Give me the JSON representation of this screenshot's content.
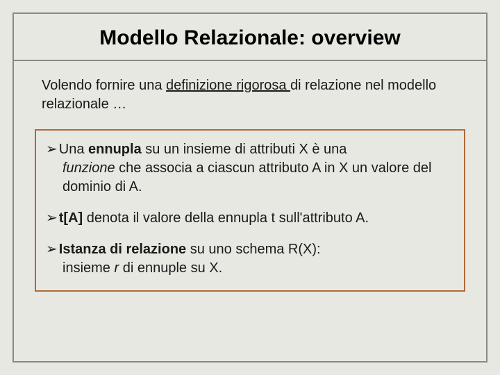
{
  "title": "Modello Relazionale: overview",
  "intro": {
    "before": "Volendo fornire una ",
    "underlined": "definizione rigorosa ",
    "after": "di relazione nel modello relazionale …"
  },
  "bullets": {
    "arrow": "➢",
    "item1": {
      "a": "Una ",
      "b": "ennupla",
      "c": " su un insieme di attributi  X  è una ",
      "d": "funzione",
      "e": " che associa a ciascun attributo  A in X un valore del dominio di A."
    },
    "item2": {
      "a": "t[A]",
      "b": " denota il valore della ennupla t sull'attributo A."
    },
    "item3": {
      "a": "Istanza di relazione",
      "b": " su uno schema  R(X): insieme ",
      "c": " r ",
      "d": " di ennuple su  X."
    }
  }
}
